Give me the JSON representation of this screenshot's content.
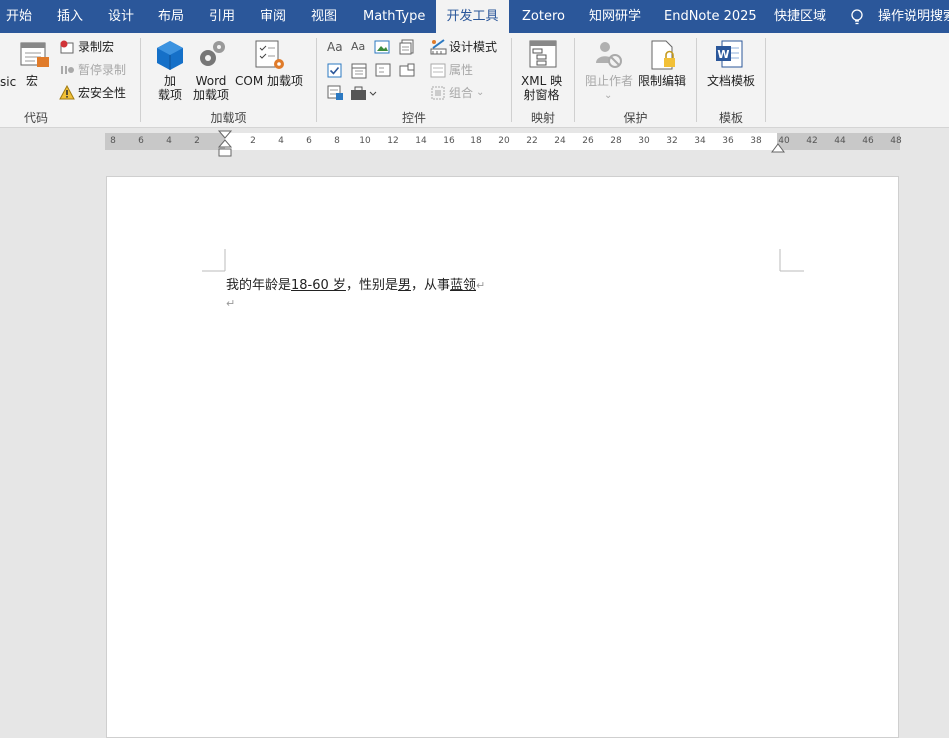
{
  "tabs": [
    "开始",
    "插入",
    "设计",
    "布局",
    "引用",
    "审阅",
    "视图",
    "MathType",
    "开发工具",
    "Zotero",
    "知网研学",
    "EndNote 2025",
    "快捷区域"
  ],
  "tell_me": "操作说明搜索",
  "ribbon": {
    "code": {
      "basic_fragment": "sic",
      "macros": "宏",
      "record": "录制宏",
      "pause": "暂停录制",
      "security": "宏安全性",
      "group": "代码"
    },
    "addins": {
      "addins": [
        "加",
        "载项"
      ],
      "word_addins": [
        "Word",
        "加载项"
      ],
      "com_addins": "COM 加载项",
      "group": "加载项"
    },
    "controls": {
      "design_mode": "设计模式",
      "properties": "属性",
      "group_btn": "组合",
      "group": "控件"
    },
    "mapping": {
      "xml_pane": [
        "XML 映",
        "射窗格"
      ],
      "group": "映射"
    },
    "protect": {
      "block_authors": "阻止作者",
      "restrict": "限制编辑",
      "group": "保护"
    },
    "templates": {
      "doc_template": "文档模板",
      "group": "模板"
    }
  },
  "ruler_ticks": [
    "8",
    "6",
    "4",
    "2",
    "2",
    "4",
    "6",
    "8",
    "10",
    "12",
    "14",
    "16",
    "18",
    "20",
    "22",
    "24",
    "26",
    "28",
    "30",
    "32",
    "34",
    "36",
    "38",
    "40",
    "42",
    "44",
    "46",
    "48"
  ],
  "document": {
    "t1": "我的年龄是",
    "age": "18-60 岁",
    "t2": "，性别是",
    "gender": "男",
    "t3": "，从事",
    "job": "蓝领"
  },
  "colors": {
    "tabbar": "#2b579a",
    "ribbon": "#f3f3f3",
    "canvas": "#e6e6e6"
  }
}
